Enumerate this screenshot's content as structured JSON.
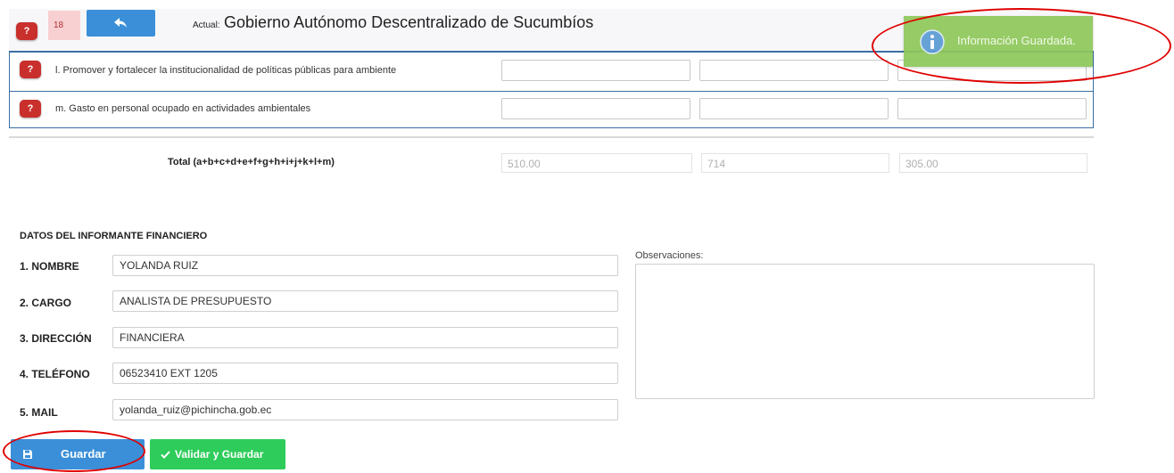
{
  "header": {
    "help": "?",
    "counter": "18",
    "back_icon": "back-arrow-icon",
    "actual_prefix": "Actual:",
    "entity_name": "Gobierno Autónomo Descentralizado de Sucumbíos"
  },
  "notification": {
    "icon": "info-icon",
    "text": "Información Guardada."
  },
  "rows": [
    {
      "help": "?",
      "label": "l. Promover y fortalecer la institucionalidad de políticas públicas para ambiente"
    },
    {
      "help": "?",
      "label": "m. Gasto en personal ocupado en actividades ambientales"
    }
  ],
  "total": {
    "label": "Total (a+b+c+d+e+f+g+h+i+j+k+l+m)",
    "values": [
      "510.00",
      "714",
      "305.00"
    ]
  },
  "informant": {
    "section_title": "DATOS DEL INFORMANTE FINANCIERO",
    "fields": [
      {
        "label": "1. NOMBRE",
        "value": "YOLANDA RUIZ"
      },
      {
        "label": "2. CARGO",
        "value": "ANALISTA DE PRESUPUESTO"
      },
      {
        "label": "3. DIRECCIÓN",
        "value": "FINANCIERA"
      },
      {
        "label": "4. TELÉFONO",
        "value": "06523410 EXT 1205"
      },
      {
        "label": "5. MAIL",
        "value": "yolanda_ruiz@pichincha.gob.ec"
      }
    ],
    "observations_label": "Observaciones:",
    "observations_value": ""
  },
  "actions": {
    "save_icon": "floppy-disk-icon",
    "save_label": "Guardar",
    "validate_icon": "checkmark-icon",
    "validate_label": "Validar y Guardar"
  },
  "colors": {
    "help_red": "#c9302c",
    "primary_blue": "#3a8fd8",
    "success_green": "#2ecc5a",
    "notification_green": "#8ec85a",
    "annotation_red": "#e00000"
  }
}
